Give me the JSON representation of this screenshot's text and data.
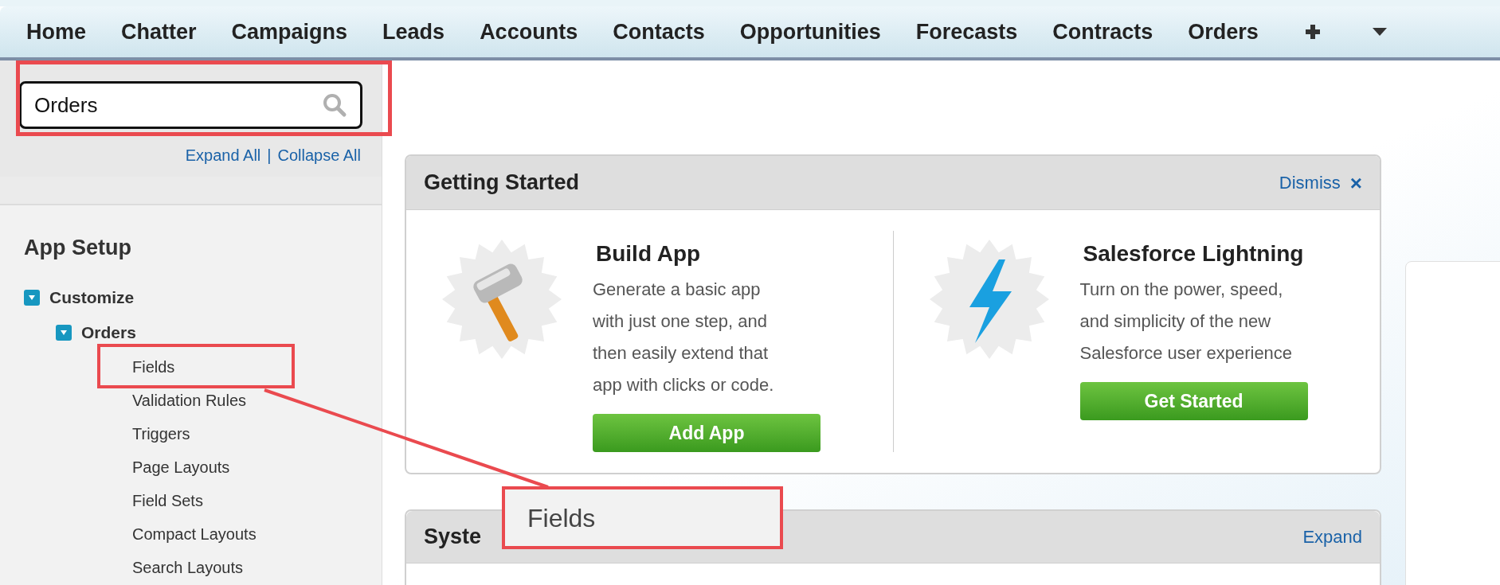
{
  "nav": {
    "tabs": [
      {
        "label": "Home"
      },
      {
        "label": "Chatter"
      },
      {
        "label": "Campaigns"
      },
      {
        "label": "Leads"
      },
      {
        "label": "Accounts"
      },
      {
        "label": "Contacts"
      },
      {
        "label": "Opportunities"
      },
      {
        "label": "Forecasts"
      },
      {
        "label": "Contracts"
      },
      {
        "label": "Orders"
      }
    ]
  },
  "sidebar": {
    "search": {
      "value": "Orders"
    },
    "expand_all": "Expand All",
    "separator": "|",
    "collapse_all": "Collapse All",
    "section_title": "App Setup",
    "tree": [
      {
        "label": "Customize",
        "expanded": true,
        "children": [
          {
            "label": "Orders",
            "expanded": true,
            "children": [
              {
                "label": "Fields"
              },
              {
                "label": "Validation Rules"
              },
              {
                "label": "Triggers"
              },
              {
                "label": "Page Layouts"
              },
              {
                "label": "Field Sets"
              },
              {
                "label": "Compact Layouts"
              },
              {
                "label": "Search Layouts"
              }
            ]
          }
        ]
      }
    ]
  },
  "getting_started": {
    "title": "Getting Started",
    "dismiss": "Dismiss",
    "dismiss_icon": "×",
    "offers": [
      {
        "kind": "hammer",
        "title": "Build App",
        "text": "Generate a basic app with just one step, and then easily extend that app with clicks or code.",
        "button": "Add App"
      },
      {
        "kind": "lightning",
        "title": "Salesforce Lightning",
        "text": "Turn on the power, speed, and simplicity of the new Salesforce user experience",
        "button": "Get Started"
      }
    ]
  },
  "system_card": {
    "title": "Syste",
    "action": "Expand"
  },
  "callout": {
    "text": "Fields"
  }
}
